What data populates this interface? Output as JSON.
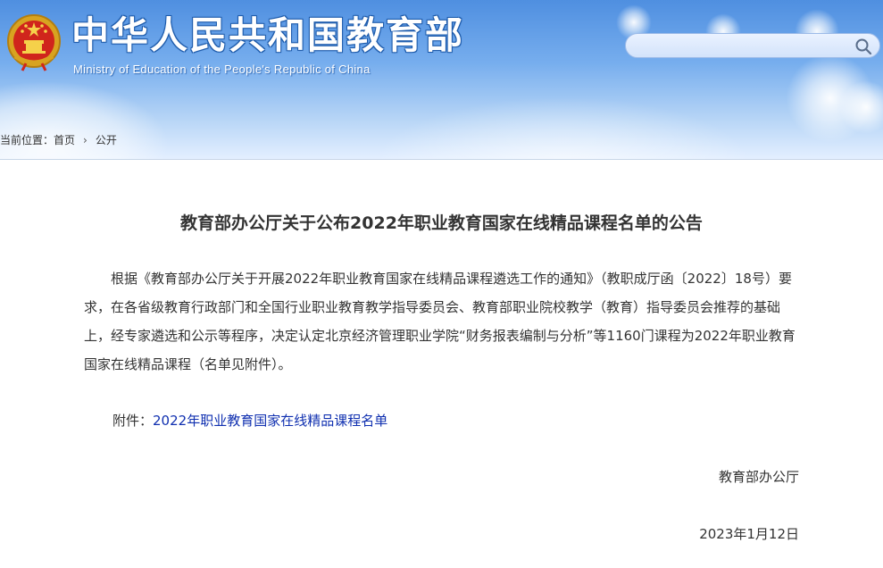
{
  "header": {
    "site_title": "中华人民共和国教育部",
    "site_subtitle": "Ministry of Education of the People's Republic of China",
    "emblem_icon": "national-emblem-icon",
    "search": {
      "placeholder": "",
      "value": "",
      "icon": "search-icon"
    }
  },
  "breadcrumb": {
    "label": "当前位置：",
    "items": [
      "首页",
      "公开"
    ],
    "separator_icon": "chevron-right-icon"
  },
  "article": {
    "title": "教育部办公厅关于公布2022年职业教育国家在线精品课程名单的公告",
    "body": "根据《教育部办公厅关于开展2022年职业教育国家在线精品课程遴选工作的通知》（教职成厅函〔2022〕18号）要求，在各省级教育行政部门和全国行业职业教育教学指导委员会、教育部职业院校教学（教育）指导委员会推荐的基础上，经专家遴选和公示等程序，决定认定北京经济管理职业学院“财务报表编制与分析”等1160门课程为2022年职业教育国家在线精品课程（名单见附件）。",
    "attachment_label": "附件：",
    "attachment_link": "2022年职业教育国家在线精品课程名单",
    "signature": "教育部办公厅",
    "date": "2023年1月12日"
  },
  "colors": {
    "header_blue": "#4f8fe0",
    "link": "#1030b0",
    "text": "#333333"
  }
}
